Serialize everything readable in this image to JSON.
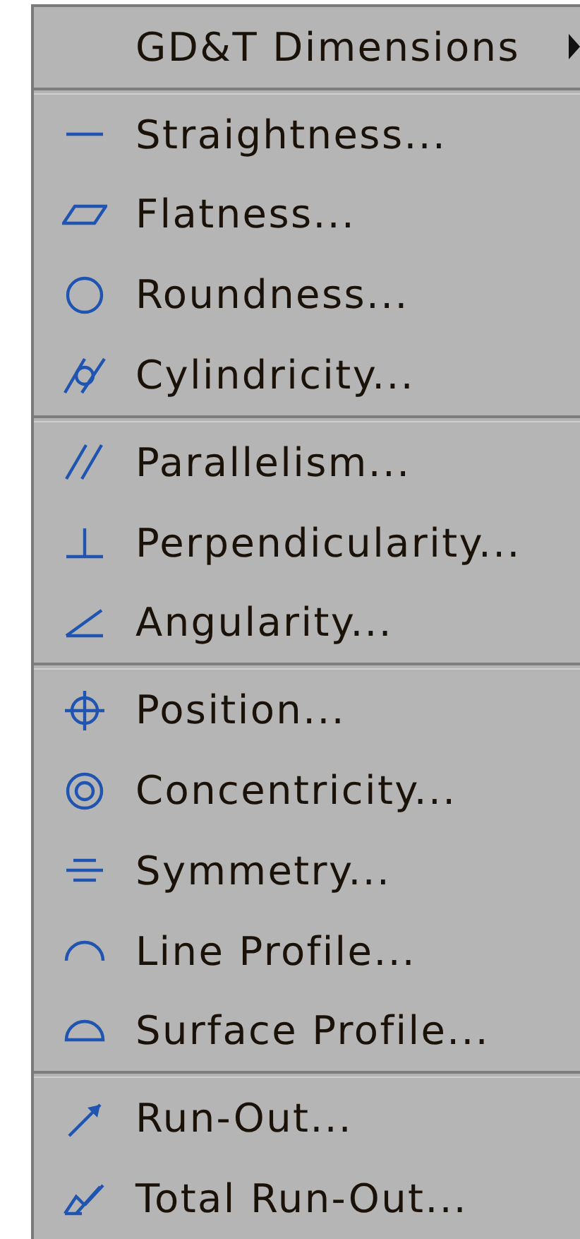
{
  "menu": {
    "header": {
      "label": "GD&T Dimensions",
      "has_submenu": true
    },
    "groups": [
      {
        "items": [
          {
            "kind": "straightness",
            "label": "Straightness..."
          },
          {
            "kind": "flatness",
            "label": "Flatness..."
          },
          {
            "kind": "roundness",
            "label": "Roundness..."
          },
          {
            "kind": "cylindricity",
            "label": "Cylindricity..."
          }
        ]
      },
      {
        "items": [
          {
            "kind": "parallelism",
            "label": "Parallelism..."
          },
          {
            "kind": "perpendicularity",
            "label": "Perpendicularity..."
          },
          {
            "kind": "angularity",
            "label": "Angularity..."
          }
        ]
      },
      {
        "items": [
          {
            "kind": "position",
            "label": "Position..."
          },
          {
            "kind": "concentricity",
            "label": "Concentricity..."
          },
          {
            "kind": "symmetry",
            "label": "Symmetry..."
          },
          {
            "kind": "line_profile",
            "label": "Line Profile..."
          },
          {
            "kind": "surface_profile",
            "label": "Surface Profile..."
          }
        ]
      },
      {
        "items": [
          {
            "kind": "runout",
            "label": "Run-Out..."
          },
          {
            "kind": "total_runout",
            "label": "Total Run-Out..."
          }
        ]
      }
    ]
  }
}
